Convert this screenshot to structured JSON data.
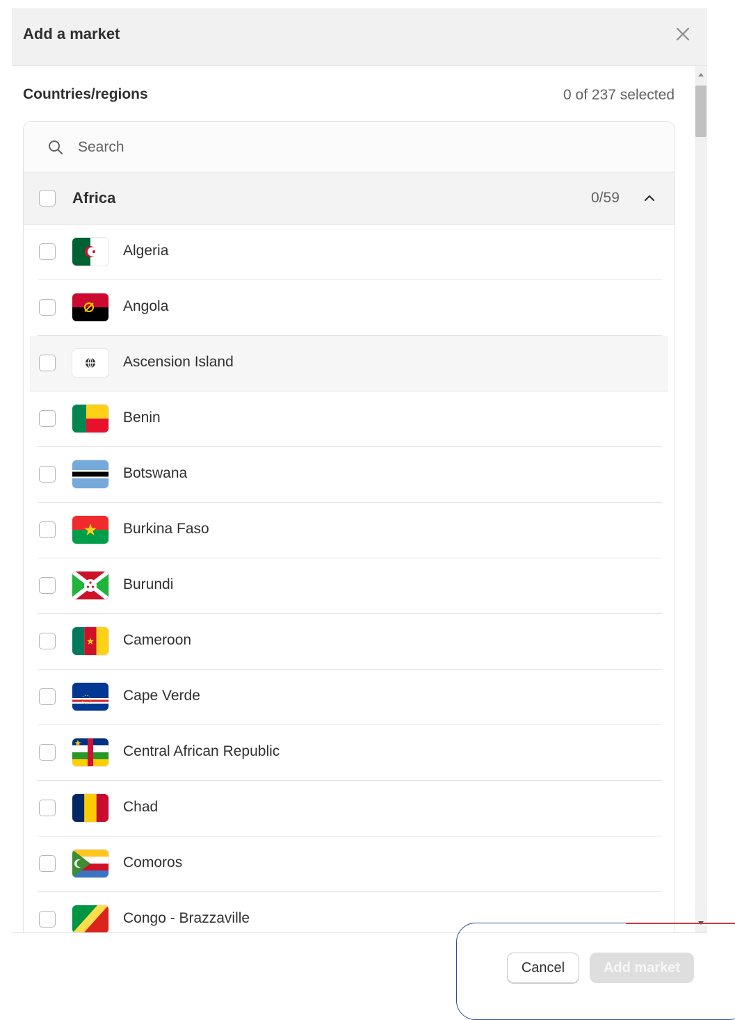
{
  "dialog": {
    "title": "Add a market",
    "close_icon": "close-icon"
  },
  "section": {
    "label": "Countries/regions",
    "selection_count": "0 of 237 selected"
  },
  "search": {
    "placeholder": "Search",
    "value": ""
  },
  "group": {
    "name": "Africa",
    "count": "0/59",
    "expanded": true
  },
  "countries": [
    {
      "name": "Algeria",
      "flag": "algeria-flag-icon",
      "checked": false
    },
    {
      "name": "Angola",
      "flag": "angola-flag-icon",
      "checked": false
    },
    {
      "name": "Ascension Island",
      "flag": "globe-icon",
      "checked": false
    },
    {
      "name": "Benin",
      "flag": "benin-flag-icon",
      "checked": false
    },
    {
      "name": "Botswana",
      "flag": "botswana-flag-icon",
      "checked": false
    },
    {
      "name": "Burkina Faso",
      "flag": "burkina-faso-flag-icon",
      "checked": false
    },
    {
      "name": "Burundi",
      "flag": "burundi-flag-icon",
      "checked": false
    },
    {
      "name": "Cameroon",
      "flag": "cameroon-flag-icon",
      "checked": false
    },
    {
      "name": "Cape Verde",
      "flag": "cape-verde-flag-icon",
      "checked": false
    },
    {
      "name": "Central African Republic",
      "flag": "central-african-republic-flag-icon",
      "checked": false
    },
    {
      "name": "Chad",
      "flag": "chad-flag-icon",
      "checked": false
    },
    {
      "name": "Comoros",
      "flag": "comoros-flag-icon",
      "checked": false
    },
    {
      "name": "Congo - Brazzaville",
      "flag": "congo-brazzaville-flag-icon",
      "checked": false
    }
  ],
  "footer": {
    "cancel_label": "Cancel",
    "add_label": "Add market",
    "add_enabled": false
  },
  "colors": {
    "header_bg": "#f1f1f1",
    "text": "#303030",
    "muted_text": "#616161",
    "disabled_button": "#dedede",
    "annotation_outline": "#2b4c9b"
  }
}
